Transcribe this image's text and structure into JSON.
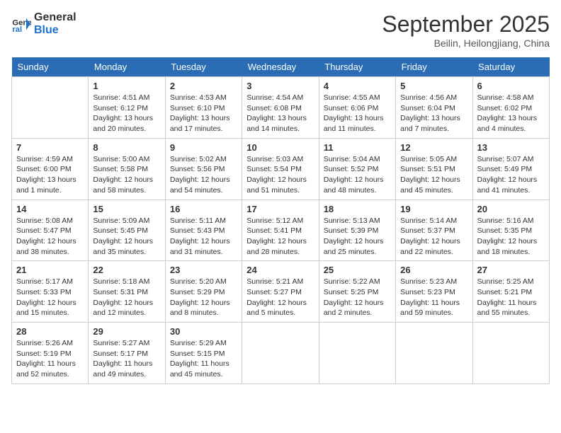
{
  "header": {
    "logo_line1": "General",
    "logo_line2": "Blue",
    "month": "September 2025",
    "location": "Beilin, Heilongjiang, China"
  },
  "weekdays": [
    "Sunday",
    "Monday",
    "Tuesday",
    "Wednesday",
    "Thursday",
    "Friday",
    "Saturday"
  ],
  "weeks": [
    [
      {
        "day": "",
        "info": ""
      },
      {
        "day": "1",
        "info": "Sunrise: 4:51 AM\nSunset: 6:12 PM\nDaylight: 13 hours\nand 20 minutes."
      },
      {
        "day": "2",
        "info": "Sunrise: 4:53 AM\nSunset: 6:10 PM\nDaylight: 13 hours\nand 17 minutes."
      },
      {
        "day": "3",
        "info": "Sunrise: 4:54 AM\nSunset: 6:08 PM\nDaylight: 13 hours\nand 14 minutes."
      },
      {
        "day": "4",
        "info": "Sunrise: 4:55 AM\nSunset: 6:06 PM\nDaylight: 13 hours\nand 11 minutes."
      },
      {
        "day": "5",
        "info": "Sunrise: 4:56 AM\nSunset: 6:04 PM\nDaylight: 13 hours\nand 7 minutes."
      },
      {
        "day": "6",
        "info": "Sunrise: 4:58 AM\nSunset: 6:02 PM\nDaylight: 13 hours\nand 4 minutes."
      }
    ],
    [
      {
        "day": "7",
        "info": "Sunrise: 4:59 AM\nSunset: 6:00 PM\nDaylight: 13 hours\nand 1 minute."
      },
      {
        "day": "8",
        "info": "Sunrise: 5:00 AM\nSunset: 5:58 PM\nDaylight: 12 hours\nand 58 minutes."
      },
      {
        "day": "9",
        "info": "Sunrise: 5:02 AM\nSunset: 5:56 PM\nDaylight: 12 hours\nand 54 minutes."
      },
      {
        "day": "10",
        "info": "Sunrise: 5:03 AM\nSunset: 5:54 PM\nDaylight: 12 hours\nand 51 minutes."
      },
      {
        "day": "11",
        "info": "Sunrise: 5:04 AM\nSunset: 5:52 PM\nDaylight: 12 hours\nand 48 minutes."
      },
      {
        "day": "12",
        "info": "Sunrise: 5:05 AM\nSunset: 5:51 PM\nDaylight: 12 hours\nand 45 minutes."
      },
      {
        "day": "13",
        "info": "Sunrise: 5:07 AM\nSunset: 5:49 PM\nDaylight: 12 hours\nand 41 minutes."
      }
    ],
    [
      {
        "day": "14",
        "info": "Sunrise: 5:08 AM\nSunset: 5:47 PM\nDaylight: 12 hours\nand 38 minutes."
      },
      {
        "day": "15",
        "info": "Sunrise: 5:09 AM\nSunset: 5:45 PM\nDaylight: 12 hours\nand 35 minutes."
      },
      {
        "day": "16",
        "info": "Sunrise: 5:11 AM\nSunset: 5:43 PM\nDaylight: 12 hours\nand 31 minutes."
      },
      {
        "day": "17",
        "info": "Sunrise: 5:12 AM\nSunset: 5:41 PM\nDaylight: 12 hours\nand 28 minutes."
      },
      {
        "day": "18",
        "info": "Sunrise: 5:13 AM\nSunset: 5:39 PM\nDaylight: 12 hours\nand 25 minutes."
      },
      {
        "day": "19",
        "info": "Sunrise: 5:14 AM\nSunset: 5:37 PM\nDaylight: 12 hours\nand 22 minutes."
      },
      {
        "day": "20",
        "info": "Sunrise: 5:16 AM\nSunset: 5:35 PM\nDaylight: 12 hours\nand 18 minutes."
      }
    ],
    [
      {
        "day": "21",
        "info": "Sunrise: 5:17 AM\nSunset: 5:33 PM\nDaylight: 12 hours\nand 15 minutes."
      },
      {
        "day": "22",
        "info": "Sunrise: 5:18 AM\nSunset: 5:31 PM\nDaylight: 12 hours\nand 12 minutes."
      },
      {
        "day": "23",
        "info": "Sunrise: 5:20 AM\nSunset: 5:29 PM\nDaylight: 12 hours\nand 8 minutes."
      },
      {
        "day": "24",
        "info": "Sunrise: 5:21 AM\nSunset: 5:27 PM\nDaylight: 12 hours\nand 5 minutes."
      },
      {
        "day": "25",
        "info": "Sunrise: 5:22 AM\nSunset: 5:25 PM\nDaylight: 12 hours\nand 2 minutes."
      },
      {
        "day": "26",
        "info": "Sunrise: 5:23 AM\nSunset: 5:23 PM\nDaylight: 11 hours\nand 59 minutes."
      },
      {
        "day": "27",
        "info": "Sunrise: 5:25 AM\nSunset: 5:21 PM\nDaylight: 11 hours\nand 55 minutes."
      }
    ],
    [
      {
        "day": "28",
        "info": "Sunrise: 5:26 AM\nSunset: 5:19 PM\nDaylight: 11 hours\nand 52 minutes."
      },
      {
        "day": "29",
        "info": "Sunrise: 5:27 AM\nSunset: 5:17 PM\nDaylight: 11 hours\nand 49 minutes."
      },
      {
        "day": "30",
        "info": "Sunrise: 5:29 AM\nSunset: 5:15 PM\nDaylight: 11 hours\nand 45 minutes."
      },
      {
        "day": "",
        "info": ""
      },
      {
        "day": "",
        "info": ""
      },
      {
        "day": "",
        "info": ""
      },
      {
        "day": "",
        "info": ""
      }
    ]
  ]
}
